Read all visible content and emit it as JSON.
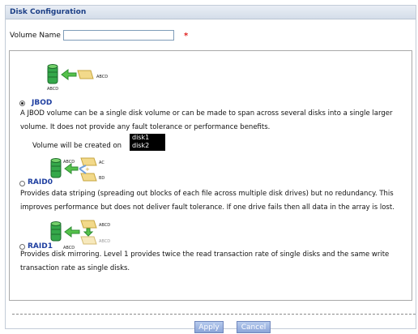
{
  "panel": {
    "title": "Disk Configuration"
  },
  "volume": {
    "label": "Volume Name",
    "value": "",
    "required_mark": "*"
  },
  "options": [
    {
      "id": "jbod",
      "name": "JBOD",
      "selected": true,
      "icon_labels": [
        "ABCD",
        "ABCD"
      ],
      "description": "A JBOD volume can be a single disk volume or can be made to span across several disks into a single larger volume. It does not provide any fault tolerance or performance benefits."
    },
    {
      "id": "raid0",
      "name": "RAID0",
      "selected": false,
      "icon_labels": [
        "ABCD",
        "AC",
        "BD"
      ],
      "description": "Provides data striping (spreading out blocks of each file across multiple disk drives) but no redundancy. This improves performance but does not deliver fault tolerance. If one drive fails then all data in the array is lost."
    },
    {
      "id": "raid1",
      "name": "RAID1",
      "selected": false,
      "icon_labels": [
        "ABCD",
        "ABCD",
        "ABCD"
      ],
      "description": "Provides disk mirroring. Level 1 provides twice the read transaction rate of single disks and the same write transaction rate as single disks."
    }
  ],
  "jbod_disks": {
    "label": "Volume will be created on",
    "items": [
      "disk1",
      "disk2"
    ]
  },
  "buttons": {
    "apply": "Apply",
    "cancel": "Cancel"
  },
  "colors": {
    "title_text": "#1c3f86",
    "option_name": "#1f3fa0",
    "required": "#e0201e",
    "button": "#8ba5d8"
  }
}
